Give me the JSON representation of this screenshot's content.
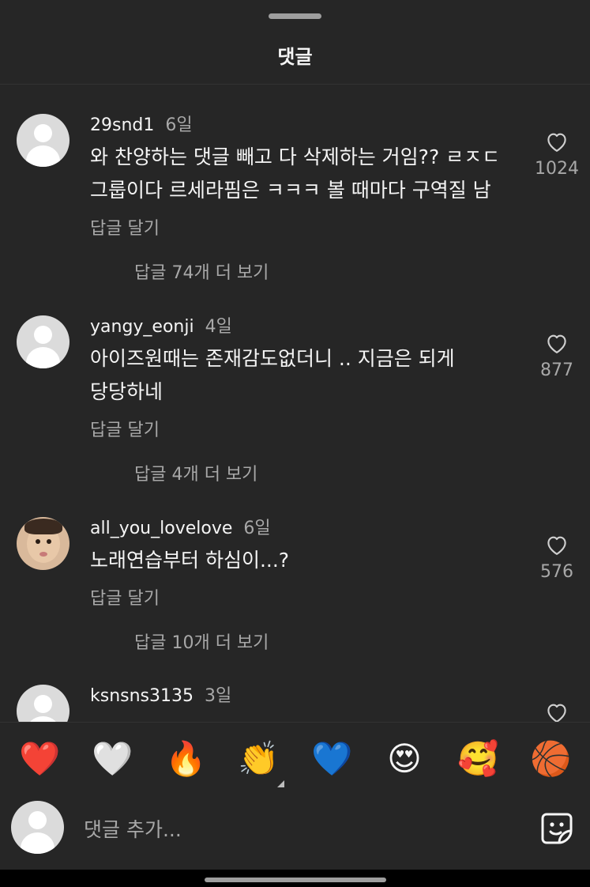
{
  "sheet": {
    "title": "댓글"
  },
  "comments": [
    {
      "username": "29snd1",
      "time": "6일",
      "lines": [
        "와 찬양하는 댓글 빼고 다 삭제하는 거임?? ㄹㅈㄷ",
        "그룹이다 르세라핌은 ㅋㅋㅋ 볼 때마다 구역질 남"
      ],
      "reply_label": "답글 달기",
      "more_replies": "답글 74개 더 보기",
      "likes": "1024",
      "avatar": "default"
    },
    {
      "username": "yangy_eonji",
      "time": "4일",
      "lines": [
        "아이즈원때는 존재감도없더니 .. 지금은 되게",
        "당당하네"
      ],
      "reply_label": "답글 달기",
      "more_replies": "답글 4개 더 보기",
      "likes": "877",
      "avatar": "default"
    },
    {
      "username": "all_you_lovelove",
      "time": "6일",
      "lines": [
        "노래연습부터 하심이...?"
      ],
      "reply_label": "답글 달기",
      "more_replies": "답글 10개 더 보기",
      "likes": "576",
      "avatar": "photo"
    },
    {
      "username": "ksnsns3135",
      "time": "3일",
      "lines": [],
      "avatar": "default"
    }
  ],
  "reactions": [
    {
      "emoji": "❤️",
      "icon": "red-heart-icon"
    },
    {
      "emoji": "🤍",
      "icon": "white-heart-icon"
    },
    {
      "emoji": "🔥",
      "icon": "fire-icon"
    },
    {
      "emoji": "👏",
      "icon": "clapping-hands-icon"
    },
    {
      "emoji": "💙",
      "icon": "blue-heart-icon"
    },
    {
      "emoji": "😍",
      "icon": "heart-eyes-icon"
    },
    {
      "emoji": "🥰",
      "icon": "smiling-hearts-icon"
    },
    {
      "emoji": "🏀",
      "icon": "basketball-icon"
    }
  ],
  "composer": {
    "placeholder": "댓글 추가..."
  },
  "colors": {
    "background": "#262626",
    "primary_text": "#f5f5f5",
    "secondary_text": "#a8a8a8",
    "avatar_placeholder": "#dbdbdb"
  }
}
